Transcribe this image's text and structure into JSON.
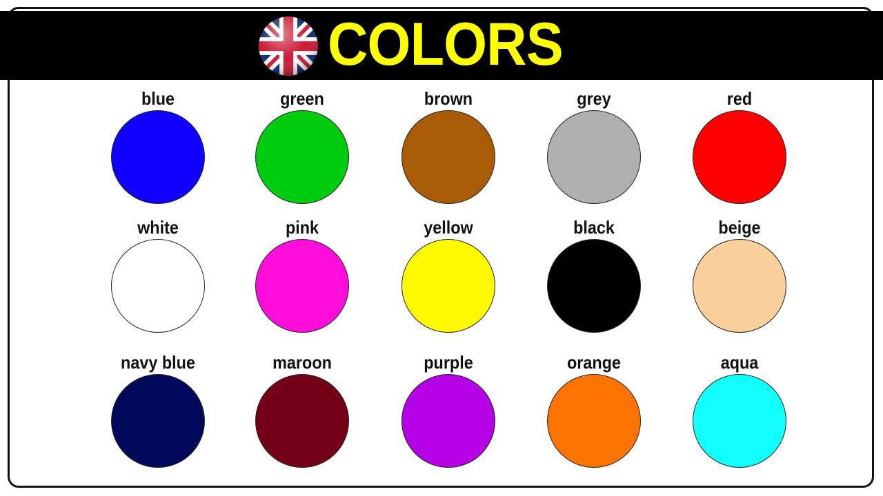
{
  "header": {
    "title": "COLORS",
    "flag_icon": "uk-flag-icon",
    "banner_color": "#000000",
    "title_color": "#ffff00"
  },
  "colors": [
    {
      "name": "blue",
      "hex": "#1100ff"
    },
    {
      "name": "green",
      "hex": "#00cc0f"
    },
    {
      "name": "brown",
      "hex": "#a95c05"
    },
    {
      "name": "grey",
      "hex": "#afafaf"
    },
    {
      "name": "red",
      "hex": "#ff0000"
    },
    {
      "name": "white",
      "hex": "#ffffff"
    },
    {
      "name": "pink",
      "hex": "#ff0ddb"
    },
    {
      "name": "yellow",
      "hex": "#fffa00"
    },
    {
      "name": "black",
      "hex": "#000000"
    },
    {
      "name": "beige",
      "hex": "#f9cf9b"
    },
    {
      "name": "navy blue",
      "hex": "#000859"
    },
    {
      "name": "maroon",
      "hex": "#740017"
    },
    {
      "name": "purple",
      "hex": "#b400e4"
    },
    {
      "name": "orange",
      "hex": "#ff7300"
    },
    {
      "name": "aqua",
      "hex": "#11ffff"
    }
  ]
}
